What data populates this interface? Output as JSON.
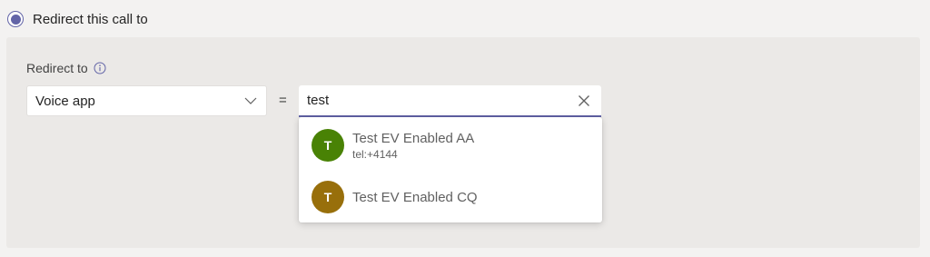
{
  "radio": {
    "label": "Redirect this call to",
    "selected": true,
    "accent": "#6264a7"
  },
  "panel": {
    "field_label": "Redirect to",
    "info_icon": "info-icon",
    "select": {
      "value": "Voice app",
      "icon": "chevron-down-icon"
    },
    "equals": "=",
    "search": {
      "value": "test",
      "clear_icon": "close-icon"
    },
    "results": [
      {
        "initial": "T",
        "title": "Test EV Enabled AA",
        "subtitle": "tel:+4144",
        "avatar_color": "#498205"
      },
      {
        "initial": "T",
        "title": "Test EV Enabled CQ",
        "subtitle": "",
        "avatar_color": "#986f0b"
      }
    ]
  }
}
